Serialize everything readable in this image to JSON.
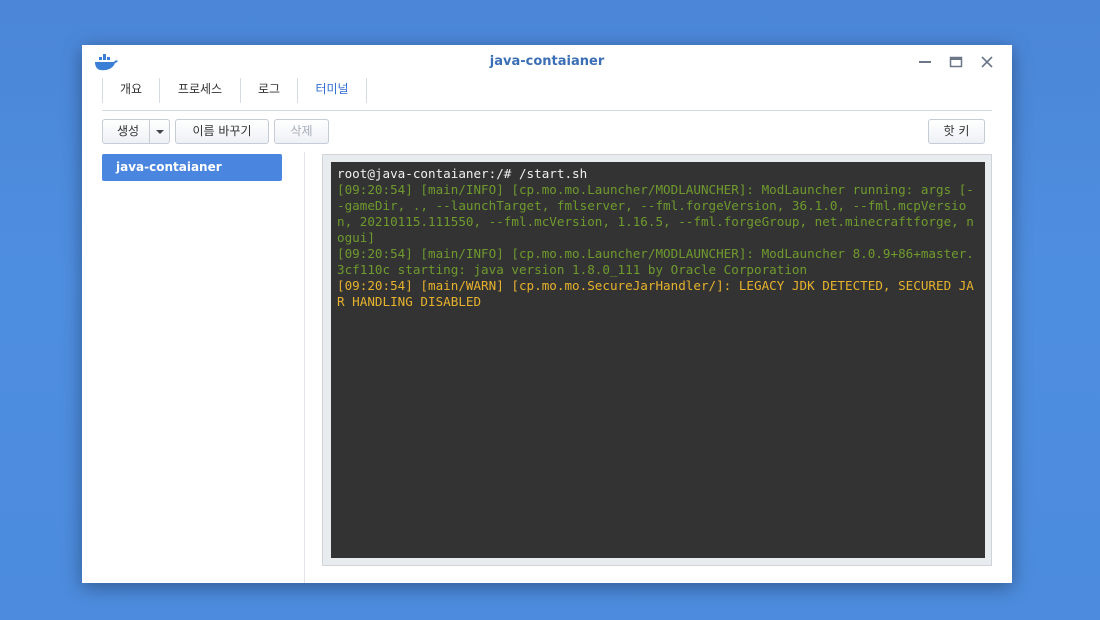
{
  "window": {
    "title": "java-contaianer",
    "icon": "docker-whale-icon",
    "controls": [
      "minimize-icon",
      "maximize-icon",
      "close-icon"
    ]
  },
  "tabs": [
    {
      "label": "개요",
      "active": false
    },
    {
      "label": "프로세스",
      "active": false
    },
    {
      "label": "로그",
      "active": false
    },
    {
      "label": "터미널",
      "active": true
    }
  ],
  "toolbar": {
    "create_label": "생성",
    "rename_label": "이름 바꾸기",
    "delete_label": "삭제",
    "hotkey_label": "핫 키"
  },
  "sidebar": {
    "items": [
      {
        "label": "java-contaianer",
        "selected": true
      }
    ]
  },
  "terminal": {
    "lines": [
      {
        "kind": "prompt",
        "text": "root@java-contaianer:/# /start.sh"
      },
      {
        "kind": "info",
        "text": "[09:20:54] [main/INFO] [cp.mo.mo.Launcher/MODLAUNCHER]: ModLauncher running: args [--gameDir, ., --launchTarget, fmlserver, --fml.forgeVersion, 36.1.0, --fml.mcpVersion, 20210115.111550, --fml.mcVersion, 1.16.5, --fml.forgeGroup, net.minecraftforge, nogui]"
      },
      {
        "kind": "info",
        "text": "[09:20:54] [main/INFO] [cp.mo.mo.Launcher/MODLAUNCHER]: ModLauncher 8.0.9+86+master.3cf110c starting: java version 1.8.0_111 by Oracle Corporation"
      },
      {
        "kind": "warn",
        "text": "[09:20:54] [main/WARN] [cp.mo.mo.SecureJarHandler/]: LEGACY JDK DETECTED, SECURED JAR HANDLING DISABLED"
      }
    ],
    "colors": {
      "background": "#333333",
      "prompt": "#f0f0f0",
      "info": "#6f9a2e",
      "warn": "#e6b22e"
    }
  }
}
